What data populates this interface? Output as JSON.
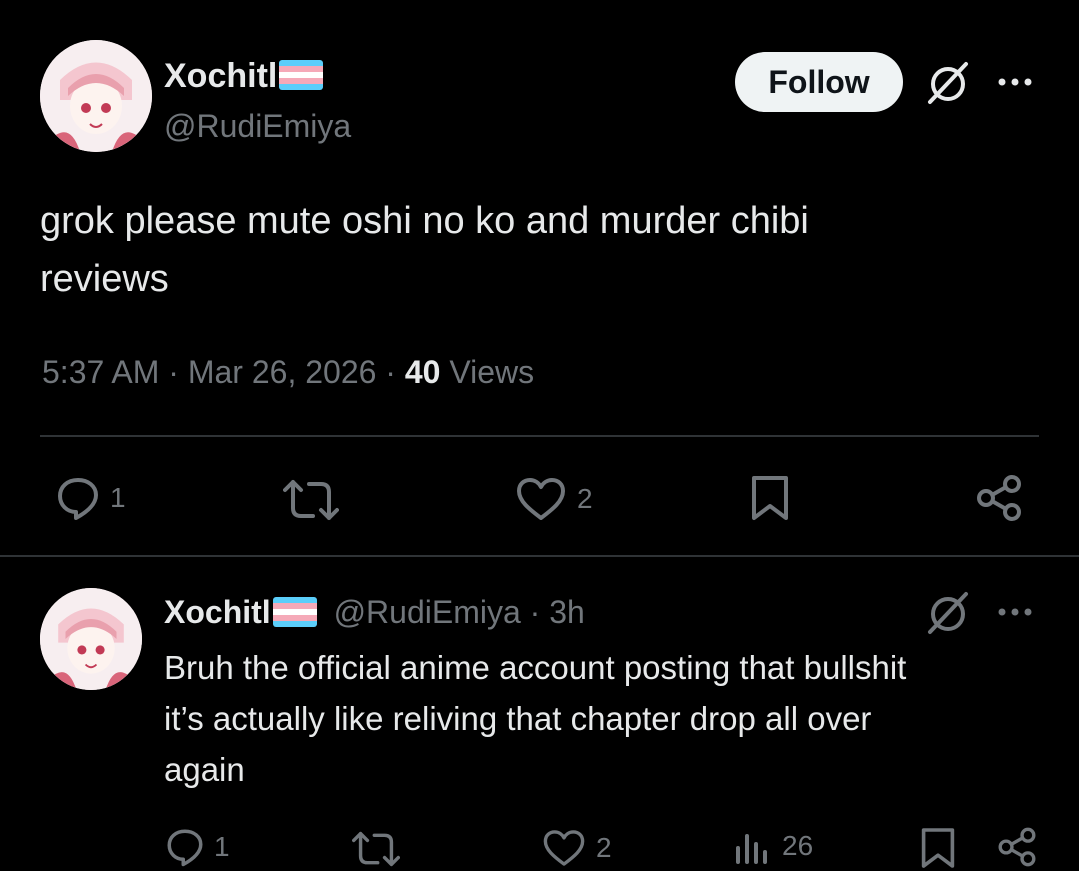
{
  "main_post": {
    "author_name": "Xochitl",
    "author_handle": "@RudiEmiya",
    "follow_label": "Follow",
    "text_line1": "grok please mute oshi no ko and murder chibi",
    "text_line2": "reviews",
    "time": "5:37 AM",
    "date": "Mar 26, 2026",
    "views_count": "40",
    "views_label": "Views",
    "separator": "·",
    "reply_count": "1",
    "like_count": "2"
  },
  "reply_post": {
    "author_name": "Xochitl",
    "author_handle": "@RudiEmiya",
    "separator": "·",
    "age": "3h",
    "text_line1": "Bruh the official anime account posting that bullshit",
    "text_line2": "it’s actually like reliving that chapter drop all over",
    "text_line3": "again",
    "reply_count": "1",
    "like_count": "2",
    "views_count": "26"
  },
  "icons": {
    "grok": "grok-icon",
    "more": "more-icon",
    "reply": "reply-icon",
    "repost": "repost-icon",
    "like": "heart-icon",
    "bookmark": "bookmark-icon",
    "share": "share-icon",
    "views": "views-icon",
    "flag": "trans-flag-icon"
  },
  "colors": {
    "background": "#000000",
    "text": "#e7e9ea",
    "secondary": "#71767b",
    "divider": "#2f3336",
    "follow_bg": "#eff3f4"
  }
}
